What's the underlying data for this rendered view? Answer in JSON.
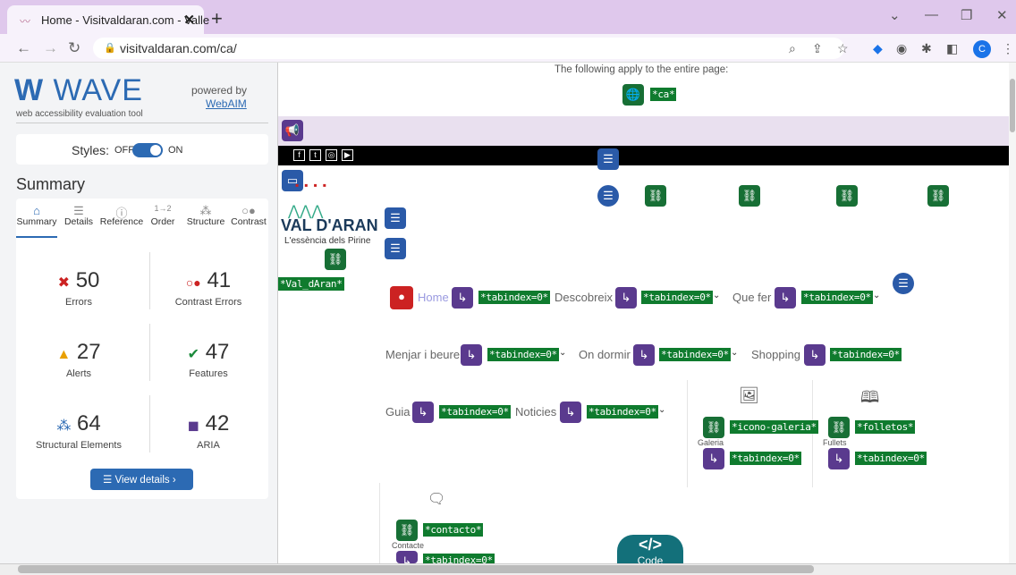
{
  "browser": {
    "tab_title": "Home - Visitvaldaran.com - Valle",
    "url": "visitvaldaran.com/ca/",
    "profile_initial": "C"
  },
  "wave": {
    "logo": "WAVE",
    "subtitle": "web accessibility evaluation tool",
    "powered_by": "powered by",
    "webaim": "WebAIM",
    "styles_label": "Styles:",
    "styles_off": "OFF",
    "styles_on": "ON",
    "summary_heading": "Summary",
    "tabs": [
      "Summary",
      "Details",
      "Reference",
      "Order",
      "Structure",
      "Contrast"
    ],
    "stats": {
      "errors": {
        "value": "50",
        "label": "Errors"
      },
      "contrast": {
        "value": "41",
        "label": "Contrast Errors"
      },
      "alerts": {
        "value": "27",
        "label": "Alerts"
      },
      "features": {
        "value": "47",
        "label": "Features"
      },
      "structural": {
        "value": "64",
        "label": "Structural Elements"
      },
      "aria": {
        "value": "42",
        "label": "ARIA"
      }
    },
    "view_details": "View details ›"
  },
  "page": {
    "entire_page": "The following apply to the entire page:",
    "lang_tag": "*ca*",
    "logo_text": "VAL D'ARAN",
    "logo_tagline": "L'essència dels Pirine",
    "val_tag": "*Val_dAran*",
    "tabindex": "*tabindex=0*",
    "nav": {
      "home": "Home",
      "descobreix": "Descobreix",
      "que_fer": "Que fer",
      "menjar": "Menjar i beure",
      "dormir": "On dormir",
      "shopping": "Shopping",
      "guia": "Guia",
      "noticies": "Noticies"
    },
    "galeria_tag": "*icono-galeria*",
    "galeria_label": "Galeria",
    "folletos_tag": "*folletos*",
    "folletos_label": "Fullets",
    "contacto_tag": "*contacto*",
    "contacte_label": "Contacte",
    "code_label": "Code"
  },
  "colors": {
    "wave_blue": "#2c6ab3",
    "tag_green": "#0f7b2e",
    "aria_purple": "#5a3a8e"
  }
}
